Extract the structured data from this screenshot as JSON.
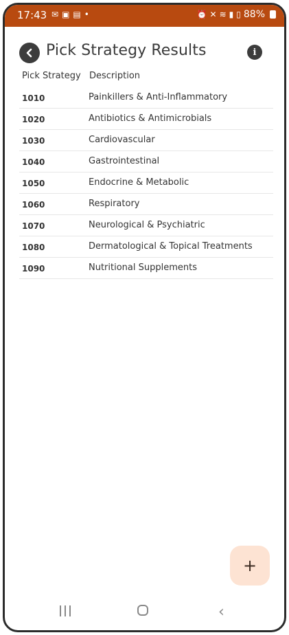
{
  "status_bar": {
    "time": "17:43",
    "battery": "88%",
    "left_icons": [
      "notification-icon",
      "teams-icon",
      "outlook-icon",
      "dot-icon"
    ],
    "right_icons": [
      "alarm-icon",
      "mute-icon",
      "wifi-icon",
      "signal-icon",
      "volte-icon",
      "signal-icon"
    ]
  },
  "header": {
    "title": "Pick Strategy Results"
  },
  "table": {
    "columns": {
      "strategy": "Pick Strategy",
      "description": "Description"
    },
    "rows": [
      {
        "code": "1010",
        "description": "Painkillers & Anti-Inflammatory"
      },
      {
        "code": "1020",
        "description": "Antibiotics & Antimicrobials"
      },
      {
        "code": "1030",
        "description": "Cardiovascular"
      },
      {
        "code": "1040",
        "description": "Gastrointestinal"
      },
      {
        "code": "1050",
        "description": "Endocrine & Metabolic"
      },
      {
        "code": "1060",
        "description": "Respiratory"
      },
      {
        "code": "1070",
        "description": "Neurological & Psychiatric"
      },
      {
        "code": "1080",
        "description": "Dermatological & Topical Treatments"
      },
      {
        "code": "1090",
        "description": "Nutritional Supplements"
      }
    ]
  },
  "fab": {
    "label": "+"
  },
  "colors": {
    "status_bar": "#b84a10",
    "fab_background": "#fde3d3",
    "icon_dark": "#3c3c3c"
  }
}
